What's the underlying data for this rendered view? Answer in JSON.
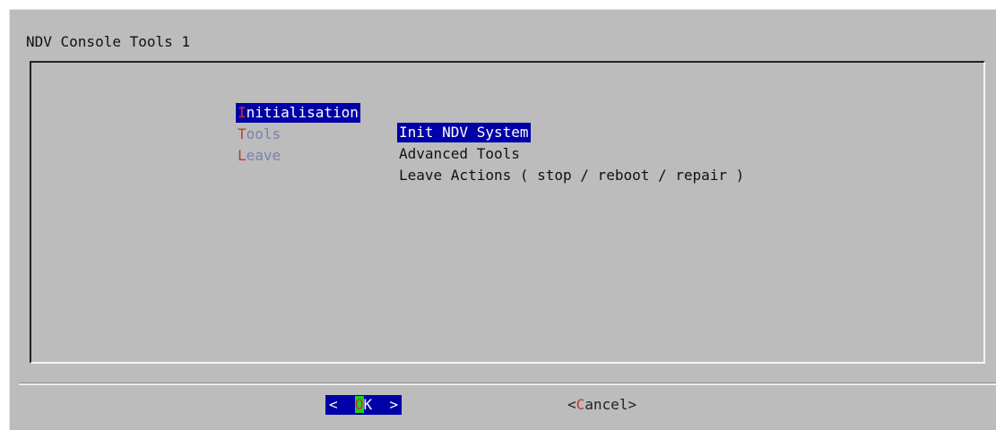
{
  "dialog": {
    "title": "NDV Console Tools 1"
  },
  "menu": {
    "items": [
      {
        "hotkey": "I",
        "tag_rest": "nitialisation",
        "description": "Init NDV System",
        "selected": true
      },
      {
        "hotkey": "T",
        "tag_rest": "ools",
        "description": "Advanced Tools",
        "selected": false
      },
      {
        "hotkey": "L",
        "tag_rest": "eave",
        "description": "Leave Actions ( stop / reboot / repair )",
        "selected": false
      }
    ]
  },
  "buttons": {
    "ok": {
      "left": "<  ",
      "hotkey": "O",
      "rest": "K  >"
    },
    "cancel": {
      "left": "<",
      "hotkey": "C",
      "rest": "ancel>"
    }
  },
  "colors": {
    "dialog_bg": "#bcbcbc",
    "selection_bg": "#0000a8",
    "hotkey": "#c0392b",
    "hotkey_highlight_bg": "#22cc22",
    "unselected_tag": "#7b7fb0"
  }
}
